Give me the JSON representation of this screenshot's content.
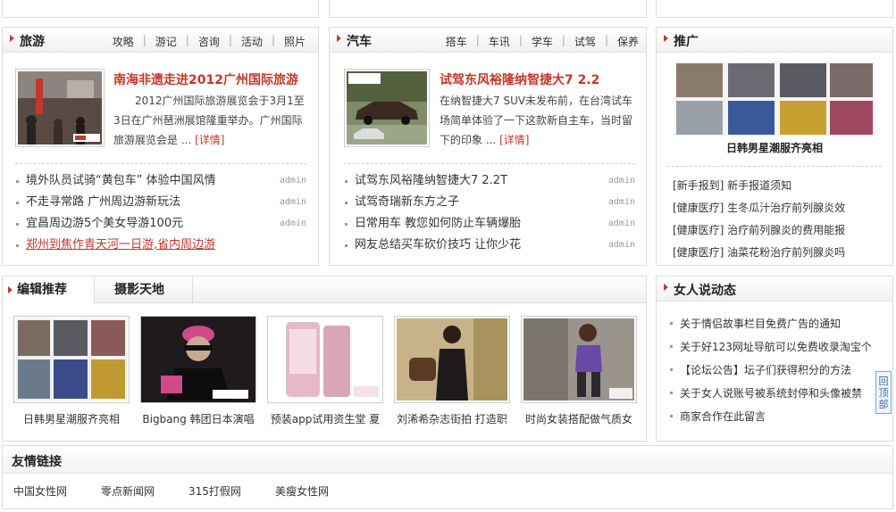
{
  "travel": {
    "title": "旅游",
    "nav": [
      "攻略",
      "游记",
      "咨询",
      "活动",
      "照片"
    ],
    "feature_title": "南海非遗走进2012广州国际旅游",
    "feature_desc": "2012广州国际旅游展览会于3月1至3日在广州琶洲展馆隆重举办。广州国际旅游展览会是 ...",
    "more_label": "[详情]",
    "items": [
      {
        "text": "境外队员试骑“黄包车” 体验中国风情",
        "author": "admin"
      },
      {
        "text": "不走寻常路 广州周边游新玩法",
        "author": "admin"
      },
      {
        "text": "宜昌周边游5个美女导游100元",
        "author": "admin"
      },
      {
        "text": "郑州到焦作青天河一日游,省内周边游",
        "author": ""
      }
    ]
  },
  "car": {
    "title": "汽车",
    "nav": [
      "搭车",
      "车讯",
      "学车",
      "试驾",
      "保养"
    ],
    "feature_title": "试驾东风裕隆纳智捷大7 2.2",
    "feature_desc": "在纳智捷大7 SUV未发布前，在台湾试车场简单体验了一下这款新自主车，当时留下的印象 ...",
    "more_label": "[详情]",
    "items": [
      {
        "text": "试驾东风裕隆纳智捷大7 2.2T",
        "author": "admin"
      },
      {
        "text": "试驾奇瑞新东方之子",
        "author": "admin"
      },
      {
        "text": "日常用车 教您如何防止车辆爆胎",
        "author": "admin"
      },
      {
        "text": "网友总结买车砍价技巧 让你少花",
        "author": "admin"
      }
    ]
  },
  "promo": {
    "title": "推广",
    "image_caption": "日韩男星潮服齐亮相",
    "items": [
      "[新手报到] 新手报道须知",
      "[健康医疗] 生冬瓜汁治疗前列腺炎效",
      "[健康医疗] 治疗前列腺炎的费用能报",
      "[健康医疗] 油菜花粉治疗前列腺炎吗"
    ]
  },
  "editor": {
    "tabs": [
      "编辑推荐",
      "摄影天地"
    ],
    "gallery": [
      {
        "caption": "日韩男星潮服齐亮相",
        "bg": "#6a6a72"
      },
      {
        "caption": "Bigbang 韩团日本演唱",
        "bg": "#1e1a1e"
      },
      {
        "caption": "预装app试用资生堂 夏",
        "bg": "#e9c6cf"
      },
      {
        "caption": "刘浠希杂志街拍 打造职",
        "bg": "#b9a07a"
      },
      {
        "caption": "时尚女装搭配做气质女",
        "bg": "#8a8580"
      }
    ]
  },
  "women": {
    "title": "女人说动态",
    "items": [
      "关于情侣故事栏目免费广告的通知",
      "关于好123网址导航可以免费收录淘宝个",
      "【论坛公告】坛子们获得积分的方法",
      "关于女人说账号被系统封停和头像被禁",
      "商家合作在此留言"
    ]
  },
  "friend_links": {
    "title": "友情链接",
    "items": [
      "中国女性网",
      "零点新闻网",
      "315打假网",
      "美瘦女性网"
    ]
  },
  "back_to_top": "回顶部"
}
